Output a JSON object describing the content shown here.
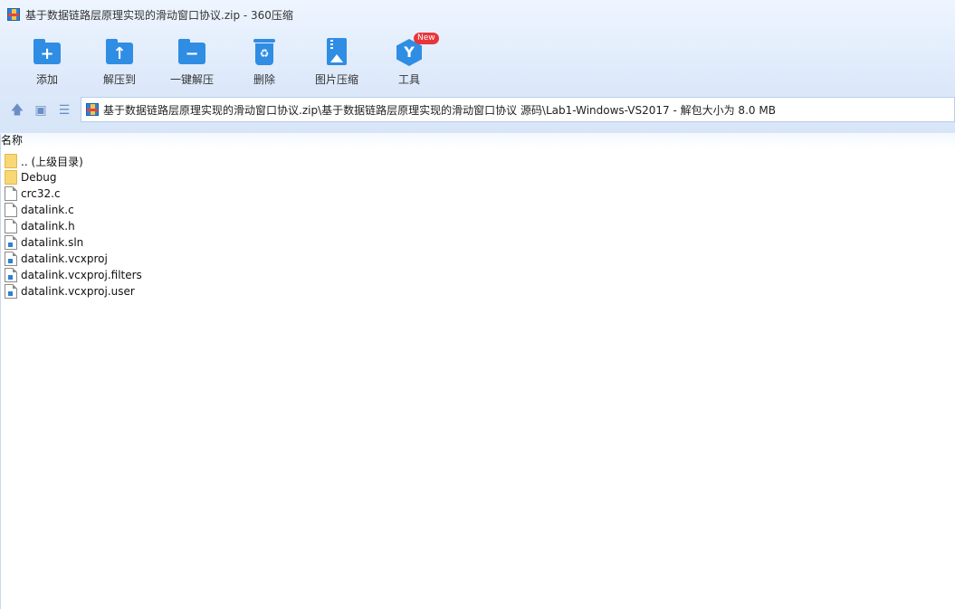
{
  "window": {
    "title": "基于数据链路层原理实现的滑动窗口协议.zip - 360压缩"
  },
  "toolbar": {
    "buttons": [
      {
        "label": "添加",
        "icon": "folder-add-icon"
      },
      {
        "label": "解压到",
        "icon": "folder-extract-icon"
      },
      {
        "label": "一键解压",
        "icon": "folder-oneclick-extract-icon"
      },
      {
        "label": "删除",
        "icon": "recycle-bin-icon"
      },
      {
        "label": "图片压缩",
        "icon": "image-compress-icon"
      },
      {
        "label": "工具",
        "icon": "tools-icon",
        "badge": "New"
      }
    ]
  },
  "nav": {
    "path": "基于数据链路层原理实现的滑动窗口协议.zip\\基于数据链路层原理实现的滑动窗口协议 源码\\Lab1-Windows-VS2017 - 解包大小为 8.0 MB"
  },
  "list": {
    "column_name": "名称",
    "items": [
      {
        "name": ".. (上级目录)",
        "type": "folder"
      },
      {
        "name": "Debug",
        "type": "folder"
      },
      {
        "name": "crc32.c",
        "type": "file"
      },
      {
        "name": "datalink.c",
        "type": "file"
      },
      {
        "name": "datalink.h",
        "type": "file"
      },
      {
        "name": "datalink.sln",
        "type": "vs-file"
      },
      {
        "name": "datalink.vcxproj",
        "type": "vs-file"
      },
      {
        "name": "datalink.vcxproj.filters",
        "type": "vs-file"
      },
      {
        "name": "datalink.vcxproj.user",
        "type": "vs-file"
      }
    ]
  },
  "colors": {
    "accent": "#2f8de4",
    "badge": "#e8353b",
    "folder": "#f8d775"
  }
}
